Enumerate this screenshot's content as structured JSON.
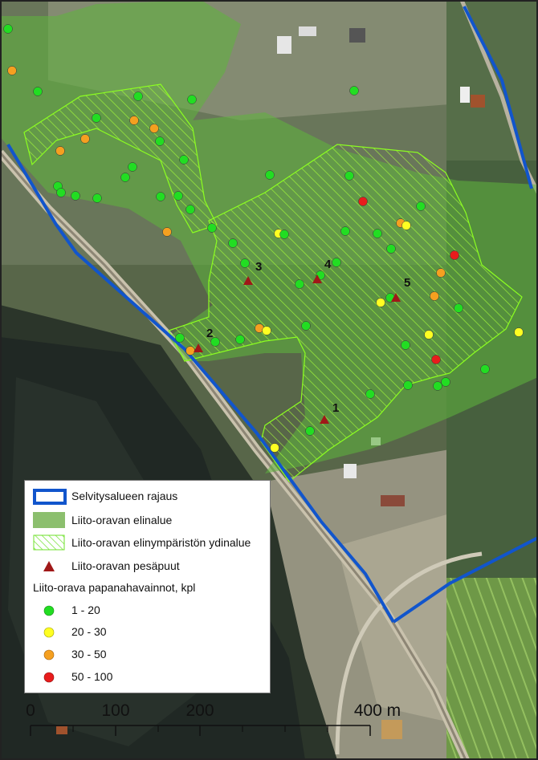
{
  "legend": {
    "boundary_label": "Selvitysalueen rajaus",
    "habitat_label": "Liito-oravan elinalue",
    "core_label": "Liito-oravan elinympäristön ydinalue",
    "nest_label": "Liito-oravan pesäpuut",
    "droppings_title": "Liito-orava papanahavainnot, kpl",
    "classes": [
      {
        "label": "1 - 20",
        "color": "#22dd22"
      },
      {
        "label": "20 - 30",
        "color": "#ffff22"
      },
      {
        "label": "30 - 50",
        "color": "#f5a020"
      },
      {
        "label": "50 - 100",
        "color": "#e81c1c"
      }
    ]
  },
  "scale": {
    "ticks": [
      "0",
      "100",
      "200",
      "400 m"
    ]
  },
  "nest_trees": [
    {
      "label": "1"
    },
    {
      "label": "2"
    },
    {
      "label": "3"
    },
    {
      "label": "4"
    },
    {
      "label": "5"
    }
  ],
  "colors": {
    "boundary": "#1155cc",
    "habitat": "#6db84a",
    "core_hatch": "#9cff2e",
    "nest": "#a01818"
  }
}
